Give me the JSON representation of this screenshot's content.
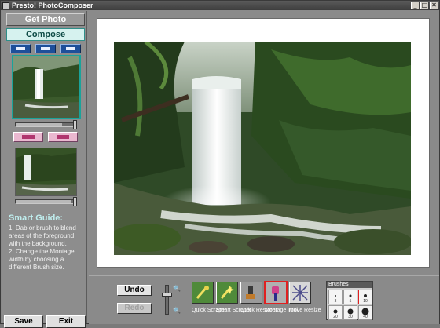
{
  "window": {
    "title": "Presto! PhotoComposer",
    "controls": {
      "minimize": "_",
      "maximize": "□",
      "close": "✕"
    }
  },
  "left_panel": {
    "get_photo_label": "Get Photo",
    "compose_label": "Compose",
    "top_icons": [
      "swap-foreground-icon",
      "swap-background-icon",
      "preview-icon"
    ],
    "middle_icons": [
      "move-forward-icon",
      "flip-icon"
    ],
    "guide": {
      "title": "Smart Guide:",
      "steps": [
        "1. Dab or brush to blend areas of the foreground with the background.",
        "2. Change the Montage width by choosing a different Brush size."
      ]
    },
    "save_label": "Save",
    "exit_label": "Exit"
  },
  "toolbar": {
    "undo_label": "Undo",
    "redo_label": "Redo",
    "tools": [
      {
        "id": "quick-scraper",
        "label": "Quick Scraper",
        "icon": "quick-scraper-icon",
        "color": "#4f8a3a"
      },
      {
        "id": "smart-scraper",
        "label": "Smart Scraper",
        "icon": "smart-scraper-icon",
        "color": "#4f8a3a"
      },
      {
        "id": "quick-restorer",
        "label": "Quick Restorer",
        "icon": "quick-restorer-icon",
        "color": "#9a9a9a"
      },
      {
        "id": "montage-tool",
        "label": "Montage Tool",
        "icon": "montage-brush-icon",
        "color": "#b0b0b0",
        "selected": true
      },
      {
        "id": "move-resize",
        "label": "Move Resize",
        "icon": "move-resize-icon",
        "color": "#d8d8d8"
      }
    ],
    "brushes_label": "Brushes",
    "brush_sizes": [
      "3",
      "5",
      "10",
      "20",
      "30",
      "40"
    ],
    "selected_brush": "10"
  },
  "colors": {
    "accent": "#1aa39a",
    "selected_outline": "#e02020"
  }
}
